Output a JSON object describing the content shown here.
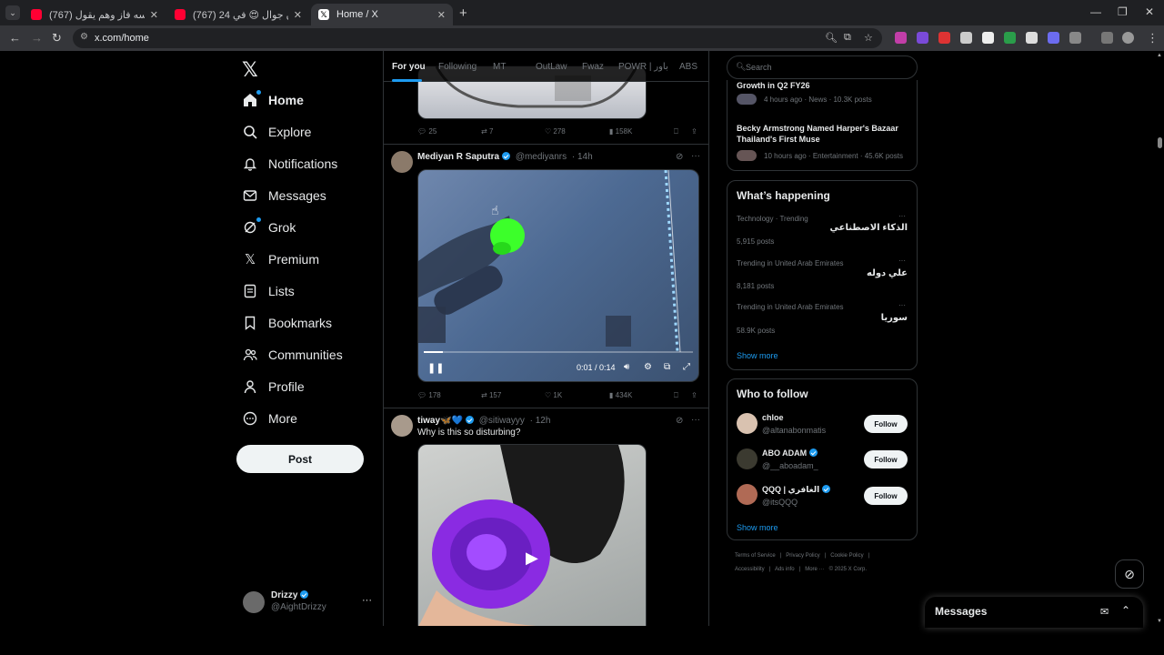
{
  "browser": {
    "tabs": [
      {
        "title": "(767) يحسب نفسه فاز وهم يقول…",
        "favicon": "youtube-icon"
      },
      {
        "title": "(767) 24 ساعة بدون جوال 😍 في…",
        "favicon": "youtube-icon"
      },
      {
        "title": "Home / X",
        "favicon": "x-icon"
      }
    ],
    "url": "x.com/home"
  },
  "sidebar": {
    "items": [
      {
        "label": "Home",
        "icon": "home-icon"
      },
      {
        "label": "Explore",
        "icon": "search-icon"
      },
      {
        "label": "Notifications",
        "icon": "bell-icon"
      },
      {
        "label": "Messages",
        "icon": "mail-icon"
      },
      {
        "label": "Grok",
        "icon": "grok-icon"
      },
      {
        "label": "Premium",
        "icon": "x-icon"
      },
      {
        "label": "Lists",
        "icon": "list-icon"
      },
      {
        "label": "Bookmarks",
        "icon": "bookmark-icon"
      },
      {
        "label": "Communities",
        "icon": "people-icon"
      },
      {
        "label": "Profile",
        "icon": "person-icon"
      },
      {
        "label": "More",
        "icon": "more-circle-icon"
      }
    ],
    "post_label": "Post",
    "account": {
      "name": "Drizzy",
      "handle": "@AightDrizzy"
    }
  },
  "feed": {
    "tabs": [
      "For you",
      "Following",
      "MT",
      "OutLaw",
      "Fwaz",
      "POWR | باور",
      "ABS"
    ],
    "tweet1_stats": {
      "replies": "25",
      "reposts": "7",
      "likes": "278",
      "views": "158K"
    },
    "tweet2": {
      "name": "Mediyan R Saputra",
      "handle": "@mediyanrs",
      "time": "· 14h",
      "video_time": "0:01 / 0:14",
      "video_progress": 0.07,
      "stats": {
        "replies": "178",
        "reposts": "157",
        "likes": "1K",
        "views": "434K"
      }
    },
    "tweet3": {
      "name": "tiway🦋💙",
      "handle": "@sitiwayyy",
      "time": "· 12h",
      "text": "Why is this so disturbing?"
    }
  },
  "right": {
    "search_placeholder": "Search",
    "news": [
      {
        "title": "Growth in Q2 FY26",
        "meta": "4 hours ago · News · 10.3K posts"
      },
      {
        "title": "Becky Armstrong Named Harper's Bazaar Thailand's First Muse",
        "meta": "10 hours ago · Entertainment · 45.6K posts"
      }
    ],
    "happening": {
      "heading": "What’s happening",
      "trends": [
        {
          "meta": "Technology · Trending",
          "title": "الذكاء الاصطناعي",
          "posts": "5,915 posts"
        },
        {
          "meta": "Trending in United Arab Emirates",
          "title": "علي دوله",
          "posts": "8,181 posts"
        },
        {
          "meta": "Trending in United Arab Emirates",
          "title": "سوريا",
          "posts": "58.9K posts"
        }
      ],
      "show_more": "Show more"
    },
    "who_to_follow": {
      "heading": "Who to follow",
      "users": [
        {
          "name": "chloe",
          "handle": "@altanabonmatis"
        },
        {
          "name": "ABO ADAM",
          "handle": "@__aboadam_"
        },
        {
          "name": "QQQ | الغافري",
          "handle": "@itsQQQ"
        }
      ],
      "follow_label": "Follow",
      "show_more": "Show more"
    },
    "footer": {
      "line1": [
        "Terms of Service",
        "|",
        "Privacy Policy",
        "|",
        "Cookie Policy",
        "|"
      ],
      "line2": [
        "Accessibility",
        "|",
        "Ads info",
        "|",
        "More ···",
        "© 2025 X Corp."
      ]
    }
  },
  "messages_drawer": {
    "title": "Messages"
  },
  "colors": {
    "accent": "#1d9bf0",
    "background": "#000000",
    "border": "#2f3336",
    "muted": "#71767b"
  }
}
